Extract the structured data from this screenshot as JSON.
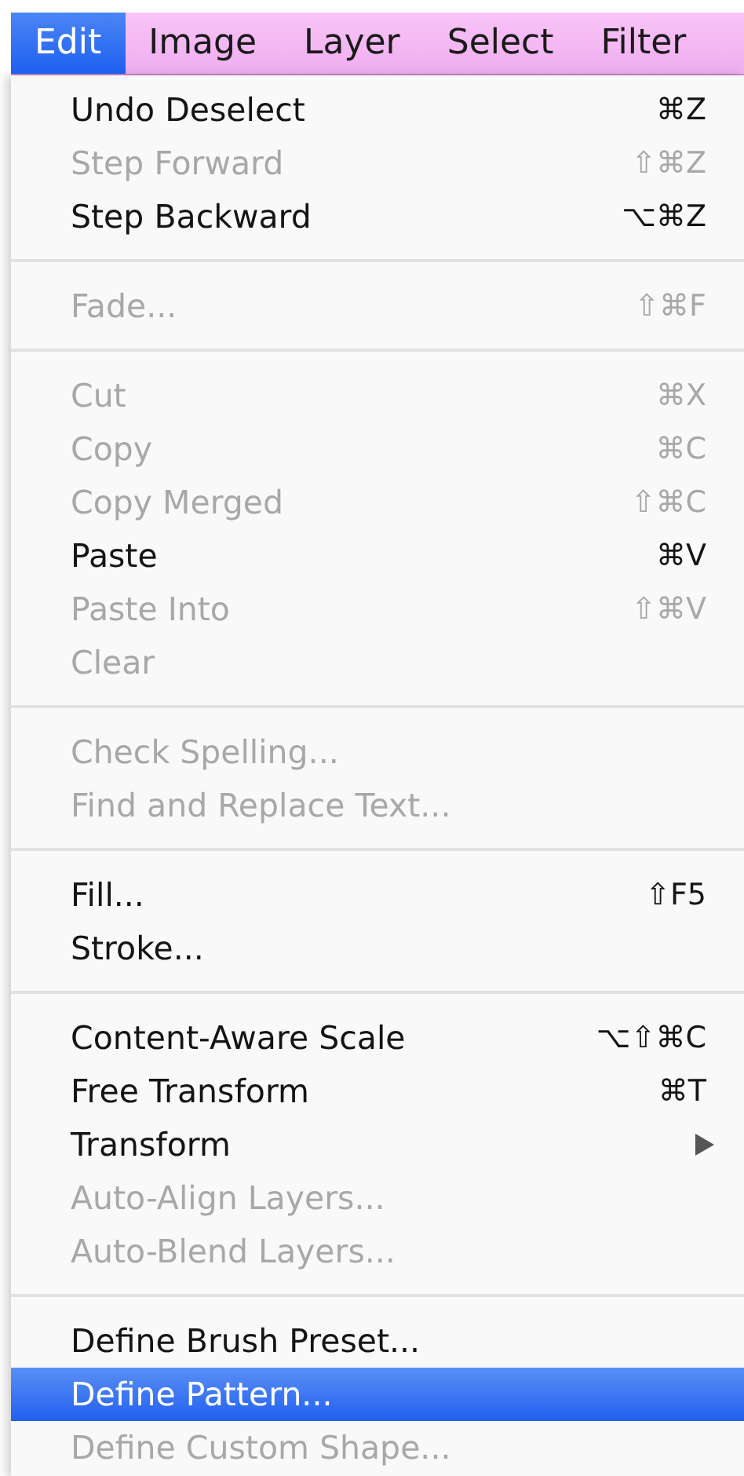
{
  "menubar": [
    {
      "label": "Edit",
      "selected": true
    },
    {
      "label": "Image",
      "selected": false
    },
    {
      "label": "Layer",
      "selected": false
    },
    {
      "label": "Select",
      "selected": false
    },
    {
      "label": "Filter",
      "selected": false
    }
  ],
  "menu": {
    "sections": [
      {
        "items": [
          {
            "label": "Undo Deselect",
            "shortcut": "⌘Z",
            "disabled": false,
            "selected": false
          },
          {
            "label": "Step Forward",
            "shortcut": "⇧⌘Z",
            "disabled": true,
            "selected": false
          },
          {
            "label": "Step Backward",
            "shortcut": "⌥⌘Z",
            "disabled": false,
            "selected": false
          }
        ]
      },
      {
        "items": [
          {
            "label": "Fade...",
            "shortcut": "⇧⌘F",
            "disabled": true,
            "selected": false
          }
        ]
      },
      {
        "items": [
          {
            "label": "Cut",
            "shortcut": "⌘X",
            "disabled": true,
            "selected": false
          },
          {
            "label": "Copy",
            "shortcut": "⌘C",
            "disabled": true,
            "selected": false
          },
          {
            "label": "Copy Merged",
            "shortcut": "⇧⌘C",
            "disabled": true,
            "selected": false
          },
          {
            "label": "Paste",
            "shortcut": "⌘V",
            "disabled": false,
            "selected": false
          },
          {
            "label": "Paste Into",
            "shortcut": "⇧⌘V",
            "disabled": true,
            "selected": false
          },
          {
            "label": "Clear",
            "disabled": true,
            "selected": false
          }
        ]
      },
      {
        "items": [
          {
            "label": "Check Spelling...",
            "disabled": true,
            "selected": false
          },
          {
            "label": "Find and Replace Text...",
            "disabled": true,
            "selected": false
          }
        ]
      },
      {
        "items": [
          {
            "label": "Fill...",
            "shortcut": "⇧F5",
            "disabled": false,
            "selected": false
          },
          {
            "label": "Stroke...",
            "disabled": false,
            "selected": false
          }
        ]
      },
      {
        "items": [
          {
            "label": "Content-Aware Scale",
            "shortcut": "⌥⇧⌘C",
            "disabled": false,
            "selected": false
          },
          {
            "label": "Free Transform",
            "shortcut": "⌘T",
            "disabled": false,
            "selected": false
          },
          {
            "label": "Transform",
            "submenu": true,
            "disabled": false,
            "selected": false
          },
          {
            "label": "Auto-Align Layers...",
            "disabled": true,
            "selected": false
          },
          {
            "label": "Auto-Blend Layers...",
            "disabled": true,
            "selected": false
          }
        ]
      },
      {
        "items": [
          {
            "label": "Define Brush Preset...",
            "disabled": false,
            "selected": false
          },
          {
            "label": "Define Pattern...",
            "disabled": false,
            "selected": true
          },
          {
            "label": "Define Custom Shape...",
            "disabled": true,
            "selected": false
          }
        ]
      }
    ]
  }
}
